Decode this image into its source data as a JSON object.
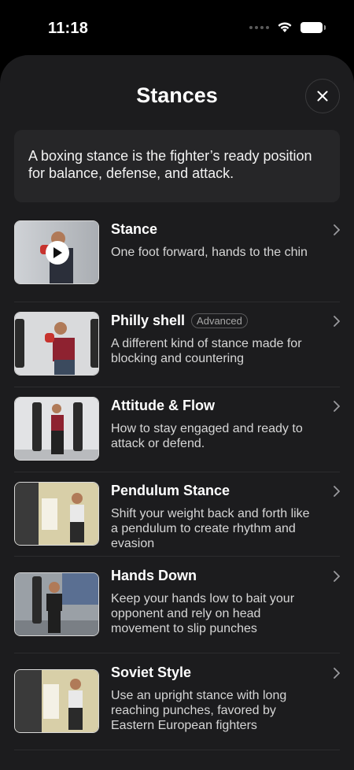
{
  "status_bar": {
    "time": "11:18"
  },
  "sheet": {
    "title": "Stances"
  },
  "intro": {
    "text": "A boxing stance is the fighter’s ready position for balance, defense, and attack."
  },
  "items": [
    {
      "title": "Stance",
      "badge": "",
      "description": "One foot forward, hands to the chin",
      "thumbnail_icon": "play-icon"
    },
    {
      "title": "Philly shell",
      "badge": "Advanced",
      "description": "A different kind of stance made for blocking and countering"
    },
    {
      "title": "Attitude & Flow",
      "badge": "",
      "description": "How to stay engaged and ready to attack or defend."
    },
    {
      "title": "Pendulum Stance",
      "badge": "",
      "description": "Shift your weight back and forth like a pendulum to create rhythm and evasion"
    },
    {
      "title": "Hands Down",
      "badge": "",
      "description": "Keep your hands low to bait your opponent and rely on head movement to slip punches"
    },
    {
      "title": "Soviet Style",
      "badge": "",
      "description": "Use an upright stance with long reaching punches, favored by Eastern European fighters"
    }
  ],
  "colors": {
    "background": "#000000",
    "sheet": "#1c1c1e",
    "card": "#262628",
    "text": "#ffffff",
    "secondary_text": "#d6d6d6"
  }
}
